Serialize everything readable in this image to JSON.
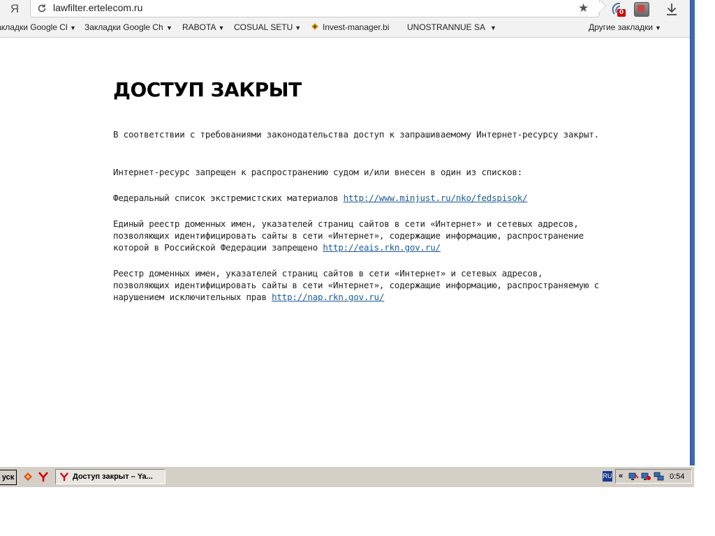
{
  "browser": {
    "logo": "Я",
    "url": "lawfilter.ertelecom.ru",
    "ext_badge": "0",
    "bookmarks": [
      {
        "label": "Закладки Google Ch",
        "arrow": "▼"
      },
      {
        "label": "Закладки Google Ch",
        "arrow": "▼"
      },
      {
        "label": "RABOTA",
        "arrow": "▼"
      },
      {
        "label": "COSUAL SETU",
        "arrow": "▼"
      },
      {
        "label": "Invest-manager.bi",
        "arrow": ""
      },
      {
        "label": "UNOSTRANNUE SAI",
        "arrow": "▼"
      }
    ],
    "other_bookmarks": {
      "label": "Другие закладки",
      "arrow": "▼"
    }
  },
  "page": {
    "title": "ДОСТУП ЗАКРЫТ",
    "p1": "В соответствии с требованиями законодательства доступ к запрашиваемому Интернет-ресурсу закрыт.",
    "p2": "Интернет-ресурс запрещен к распространению судом и/или внесен в один из списков:",
    "p3_text": "Федеральный список экстремистских материалов ",
    "p3_link": "http://www.minjust.ru/nko/fedspisok/",
    "p4_text": "Единый реестр доменных имен, указателей страниц сайтов в сети «Интернет» и сетевых адресов, позволяющих идентифицировать сайты в сети «Интернет», содержащие информацию, распространение которой в Российской Федерации запрещено ",
    "p4_link": "http://eais.rkn.gov.ru/",
    "p5_text": "Реестр доменных имен, указателей страниц сайтов в сети «Интернет» и сетевых адресов, позволяющих идентифицировать сайты в сети «Интернет», содержащие информацию, распространяемую с нарушением исключительных прав ",
    "p5_link": "http://nap.rkn.gov.ru/"
  },
  "taskbar": {
    "start_label": "уск",
    "task_label": "Доступ закрыт – Ya...",
    "lang": "RU",
    "tray_arrow": "«",
    "clock": "0:54"
  },
  "colors": {
    "link": "#1a5a9a",
    "frame_accent": "#3c6ab4",
    "taskbar": "#d4d0c8"
  }
}
